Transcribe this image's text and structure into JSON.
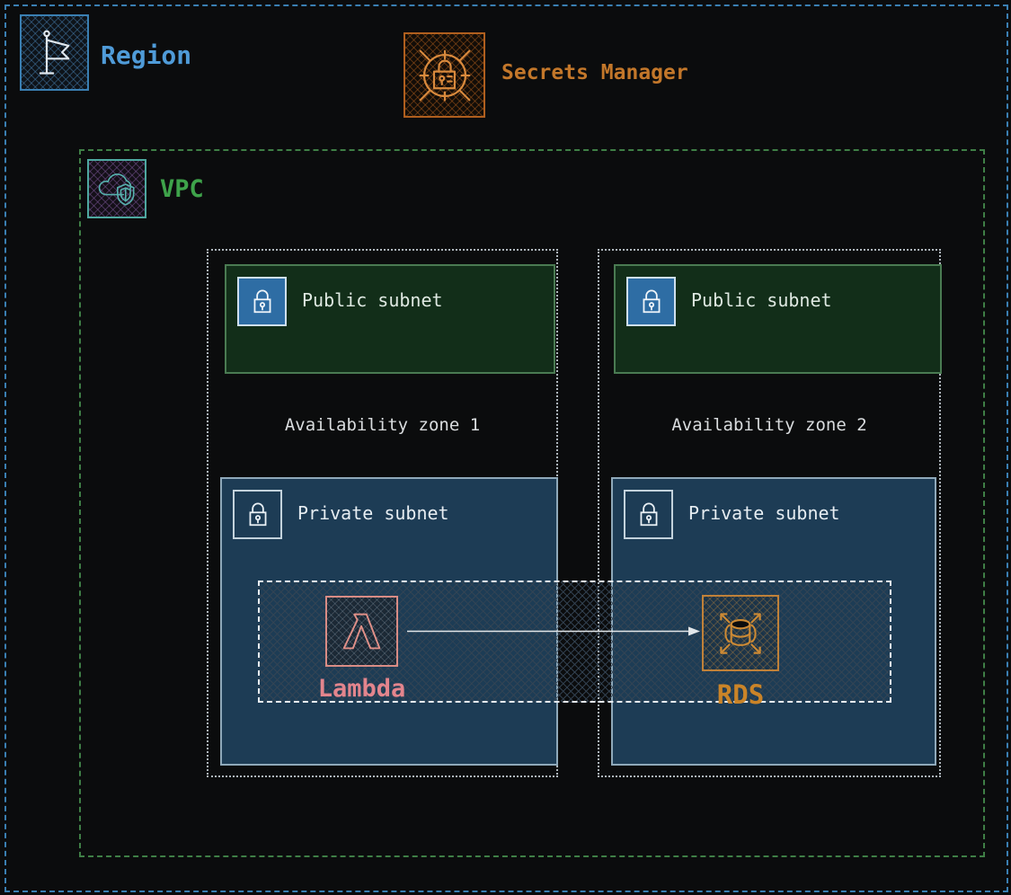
{
  "diagram_type": "aws-architecture",
  "region": {
    "label": "Region",
    "color": "#4f9bd8",
    "border_color": "#3a7fb2"
  },
  "secrets_manager": {
    "label": "Secrets Manager",
    "color": "#c3772a"
  },
  "vpc": {
    "label": "VPC",
    "color": "#3ea34a",
    "border_color": "#3f7f46"
  },
  "availability_zones": [
    {
      "label": "Availability zone 1",
      "public_subnet": {
        "label": "Public subnet",
        "fill": "#122e19"
      },
      "private_subnet": {
        "label": "Private subnet",
        "fill": "#1d3c55"
      }
    },
    {
      "label": "Availability zone 2",
      "public_subnet": {
        "label": "Public subnet",
        "fill": "#122e19"
      },
      "private_subnet": {
        "label": "Private subnet",
        "fill": "#1d3c55"
      }
    }
  ],
  "security_group": {
    "border_color": "#e8eef4",
    "nodes": [
      {
        "label": "Lambda",
        "color": "#e3858d"
      },
      {
        "label": "RDS",
        "color": "#ca8428"
      }
    ],
    "connection": {
      "from": "Lambda",
      "to": "RDS",
      "arrow_color": "#e3e7ea"
    }
  },
  "colors": {
    "background": "#0b0c0d",
    "az_border": "#aeb6bc",
    "public_subnet_border": "#4a7b52",
    "private_subnet_border": "#8fa9ba",
    "lock_icon_public_fill": "#2e6da4"
  }
}
